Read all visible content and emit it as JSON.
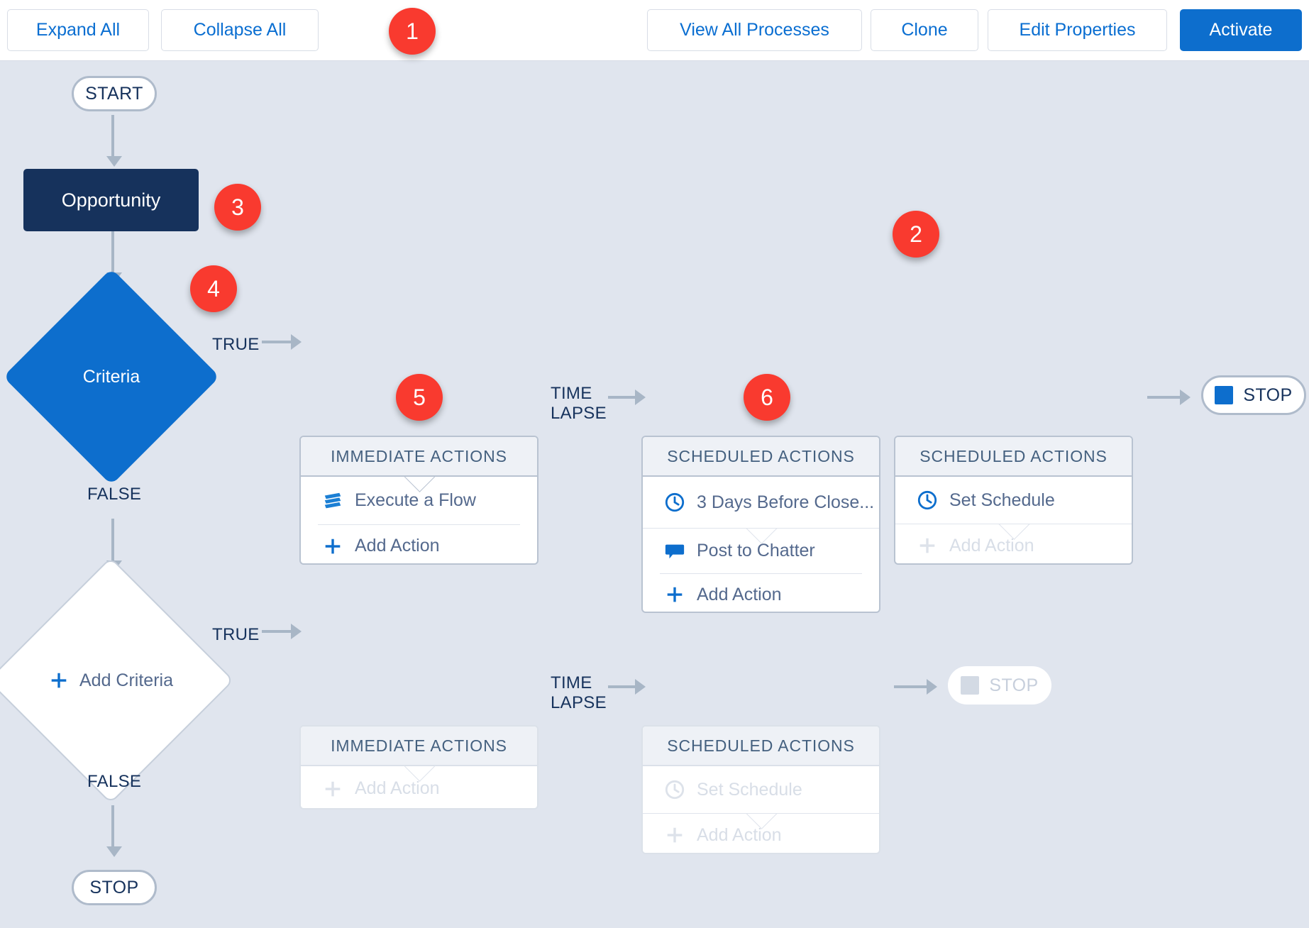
{
  "toolbar": {
    "expand_all": "Expand All",
    "collapse_all": "Collapse All",
    "view_all_processes": "View All Processes",
    "clone": "Clone",
    "edit_properties": "Edit Properties",
    "activate": "Activate"
  },
  "colors": {
    "canvas_background": "#e0e5ee",
    "accent_blue": "#0d6ecd",
    "object_navy": "#16325c",
    "badge_red": "#f93a2f",
    "connector_gray": "#a8b6c6",
    "card_border": "#b9c3d1",
    "card_header_bg": "#eef1f6",
    "muted_text": "#d8dee7"
  },
  "badges": [
    {
      "number": "1"
    },
    {
      "number": "2"
    },
    {
      "number": "3"
    },
    {
      "number": "4"
    },
    {
      "number": "5"
    },
    {
      "number": "6"
    }
  ],
  "flow": {
    "start_node": "START",
    "object_node": "Opportunity",
    "criteria_node": "Criteria",
    "add_criteria_node": "Add Criteria",
    "stop_node_right": "STOP",
    "stop_node_bottom": "STOP",
    "stop_node_ghost": "STOP",
    "edge_true_1": "TRUE",
    "edge_false_1": "FALSE",
    "edge_true_2": "TRUE",
    "edge_false_2": "FALSE",
    "time_lapse_1_line1": "TIME",
    "time_lapse_1_line2": "LAPSE",
    "time_lapse_2_line1": "TIME",
    "time_lapse_2_line2": "LAPSE"
  },
  "cards": {
    "immediate_1": {
      "header": "IMMEDIATE ACTIONS",
      "rows": [
        {
          "label": "Execute a Flow",
          "icon": "flow-icon",
          "muted": false
        },
        {
          "label": "Add Action",
          "icon": "plus-icon",
          "muted": false
        }
      ]
    },
    "scheduled_1": {
      "header": "SCHEDULED ACTIONS",
      "rows": [
        {
          "label": "3 Days Before Close...",
          "icon": "clock-icon",
          "muted": false
        },
        {
          "label": "Post to Chatter",
          "icon": "chatter-icon",
          "muted": false
        },
        {
          "label": "Add Action",
          "icon": "plus-icon",
          "muted": false
        }
      ]
    },
    "scheduled_2": {
      "header": "SCHEDULED ACTIONS",
      "rows": [
        {
          "label": "Set Schedule",
          "icon": "clock-icon",
          "muted": false
        },
        {
          "label": "Add Action",
          "icon": "plus-icon",
          "muted": true
        }
      ]
    },
    "immediate_2": {
      "header": "IMMEDIATE ACTIONS",
      "rows": [
        {
          "label": "Add Action",
          "icon": "plus-icon",
          "muted": true
        }
      ]
    },
    "scheduled_3": {
      "header": "SCHEDULED ACTIONS",
      "rows": [
        {
          "label": "Set Schedule",
          "icon": "clock-icon",
          "muted": true
        },
        {
          "label": "Add Action",
          "icon": "plus-icon",
          "muted": true
        }
      ]
    }
  }
}
